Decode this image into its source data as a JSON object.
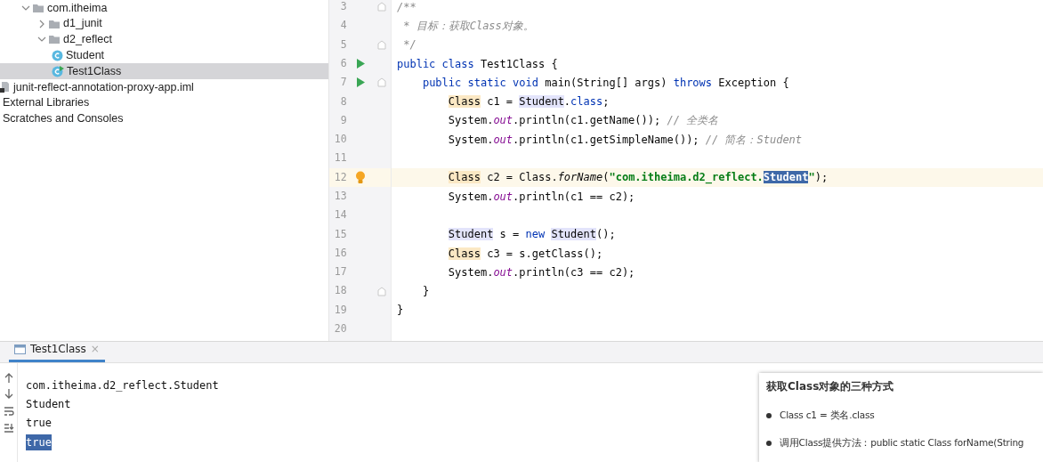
{
  "project_tree": [
    {
      "label": "com.itheima",
      "kind": "package",
      "expanded": true,
      "selected": false,
      "children": [
        {
          "label": "d1_junit",
          "kind": "package",
          "expanded": false,
          "selected": false
        },
        {
          "label": "d2_reflect",
          "kind": "package",
          "expanded": true,
          "selected": false,
          "children": [
            {
              "label": "Student",
              "kind": "class",
              "selected": false
            },
            {
              "label": "Test1Class",
              "kind": "run-class",
              "selected": true
            }
          ]
        }
      ]
    },
    {
      "label": "junit-reflect-annotation-proxy-app.iml",
      "kind": "module-file",
      "selected": false
    },
    {
      "label": "External Libraries",
      "kind": "plain",
      "selected": false
    },
    {
      "label": "Scratches and Consoles",
      "kind": "plain",
      "selected": false
    }
  ],
  "editor": {
    "lines": [
      {
        "number": "3",
        "run": false,
        "fold": true,
        "bulb": false,
        "current": false,
        "tokens": [
          {
            "kind": "comment",
            "text": "/**"
          }
        ]
      },
      {
        "number": "4",
        "run": false,
        "fold": false,
        "bulb": false,
        "current": false,
        "tokens": [
          {
            "kind": "comment",
            "text": " * 目标：获取Class对象。"
          }
        ]
      },
      {
        "number": "5",
        "run": false,
        "fold": true,
        "bulb": false,
        "current": false,
        "tokens": [
          {
            "kind": "comment",
            "text": " */"
          }
        ]
      },
      {
        "number": "6",
        "run": true,
        "fold": false,
        "bulb": false,
        "current": false,
        "tokens": [
          {
            "kind": "keyword",
            "text": "public class "
          },
          {
            "kind": "plain",
            "text": "Test1Class {"
          }
        ]
      },
      {
        "number": "7",
        "run": true,
        "fold": true,
        "bulb": false,
        "current": false,
        "tokens": [
          {
            "kind": "keyword",
            "text": "    public static void "
          },
          {
            "kind": "plain",
            "text": "main(String[] args) "
          },
          {
            "kind": "keyword",
            "text": "throws "
          },
          {
            "kind": "plain",
            "text": "Exception {"
          }
        ]
      },
      {
        "number": "8",
        "run": false,
        "fold": false,
        "bulb": false,
        "current": false,
        "tokens": [
          {
            "kind": "type-usage",
            "text": "        Class"
          },
          {
            "kind": "plain",
            "text": " c1 = "
          },
          {
            "kind": "class-usage",
            "text": "Student"
          },
          {
            "kind": "plain",
            "text": "."
          },
          {
            "kind": "keyword",
            "text": "class"
          },
          {
            "kind": "plain",
            "text": ";"
          }
        ]
      },
      {
        "number": "9",
        "run": false,
        "fold": false,
        "bulb": false,
        "current": false,
        "tokens": [
          {
            "kind": "plain",
            "text": "        System."
          },
          {
            "kind": "static",
            "text": "out"
          },
          {
            "kind": "plain",
            "text": ".println(c1.getName()); "
          },
          {
            "kind": "comment",
            "text": "// 全类名"
          }
        ]
      },
      {
        "number": "10",
        "run": false,
        "fold": false,
        "bulb": false,
        "current": false,
        "tokens": [
          {
            "kind": "plain",
            "text": "        System."
          },
          {
            "kind": "static",
            "text": "out"
          },
          {
            "kind": "plain",
            "text": ".println(c1.getSimpleName()); "
          },
          {
            "kind": "comment",
            "text": "// 简名：Student"
          }
        ]
      },
      {
        "number": "11",
        "run": false,
        "fold": false,
        "bulb": false,
        "current": false
      },
      {
        "number": "12",
        "run": false,
        "fold": false,
        "bulb": true,
        "current": true,
        "tokens": [
          {
            "kind": "type-usage",
            "text": "        Class"
          },
          {
            "kind": "plain",
            "text": " c2 = Class."
          },
          {
            "kind": "method-static",
            "text": "forName"
          },
          {
            "kind": "plain",
            "text": "("
          },
          {
            "kind": "string",
            "text": "\"com.itheima.d2_reflect."
          },
          {
            "kind": "string-selected",
            "text": "Student"
          },
          {
            "kind": "string",
            "text": "\""
          },
          {
            "kind": "plain",
            "text": ");"
          }
        ]
      },
      {
        "number": "13",
        "run": false,
        "fold": false,
        "bulb": false,
        "current": false,
        "tokens": [
          {
            "kind": "plain",
            "text": "        System."
          },
          {
            "kind": "static",
            "text": "out"
          },
          {
            "kind": "plain",
            "text": ".println(c1 == c2);"
          }
        ]
      },
      {
        "number": "14",
        "run": false,
        "fold": false,
        "bulb": false,
        "current": false
      },
      {
        "number": "15",
        "run": false,
        "fold": false,
        "bulb": false,
        "current": false,
        "tokens": [
          {
            "kind": "class-usage",
            "text": "        Student"
          },
          {
            "kind": "plain",
            "text": " s = "
          },
          {
            "kind": "keyword",
            "text": "new "
          },
          {
            "kind": "class-usage",
            "text": "Student"
          },
          {
            "kind": "plain",
            "text": "();"
          }
        ]
      },
      {
        "number": "16",
        "run": false,
        "fold": false,
        "bulb": false,
        "current": false,
        "tokens": [
          {
            "kind": "type-usage",
            "text": "        Class"
          },
          {
            "kind": "plain",
            "text": " c3 = s.getClass();"
          }
        ]
      },
      {
        "number": "17",
        "run": false,
        "fold": false,
        "bulb": false,
        "current": false,
        "tokens": [
          {
            "kind": "plain",
            "text": "        System."
          },
          {
            "kind": "static",
            "text": "out"
          },
          {
            "kind": "plain",
            "text": ".println(c3 == c2);"
          }
        ]
      },
      {
        "number": "18",
        "run": false,
        "fold": true,
        "bulb": false,
        "current": false,
        "tokens": [
          {
            "kind": "plain",
            "text": "    }"
          }
        ]
      },
      {
        "number": "19",
        "run": false,
        "fold": false,
        "bulb": false,
        "current": false,
        "tokens": [
          {
            "kind": "plain",
            "text": "}"
          }
        ]
      },
      {
        "number": "20",
        "run": false,
        "fold": false,
        "bulb": false,
        "current": false
      }
    ]
  },
  "run_panel": {
    "tab": {
      "label": "Test1Class",
      "close": "×",
      "selected": true
    },
    "output": [
      {
        "text": "com.itheima.d2_reflect.Student",
        "selected": false
      },
      {
        "text": "Student",
        "selected": false
      },
      {
        "text": "true",
        "selected": false
      },
      {
        "text": "true",
        "selected": true
      }
    ]
  },
  "note": {
    "title": "获取Class对象的三种方式",
    "bullets": [
      "Class c1 = 类名.class",
      "调用Class提供方法：public static Class forName(String"
    ]
  }
}
